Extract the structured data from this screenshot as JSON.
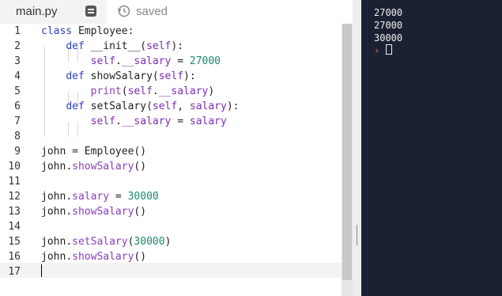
{
  "tab": {
    "filename": "main.py",
    "file_icon": "file-icon"
  },
  "status": {
    "text": "saved",
    "icon": "history-icon"
  },
  "editor": {
    "line_numbers": [
      "1",
      "2",
      "3",
      "4",
      "5",
      "6",
      "7",
      "8",
      "9",
      "10",
      "11",
      "12",
      "13",
      "14",
      "15",
      "16",
      "17"
    ],
    "lines": [
      "class Employee:",
      "    def __init__(self):",
      "        self.__salary = 27000",
      "    def showSalary(self):",
      "        print(self.__salary)",
      "    def setSalary(self, salary):",
      "        self.__salary = salary",
      "",
      "john = Employee()",
      "john.showSalary()",
      "",
      "john.salary = 30000",
      "john.showSalary()",
      "",
      "john.setSalary(30000)",
      "john.showSalary()",
      ""
    ]
  },
  "console": {
    "output": [
      "27000",
      "27000",
      "30000"
    ],
    "prompt": "›"
  },
  "colors": {
    "keyword": "#2d3fc8",
    "param": "#7b2bb6",
    "number": "#1a8a6a",
    "console_bg": "#1b2132",
    "prompt": "#ff6a2a"
  }
}
